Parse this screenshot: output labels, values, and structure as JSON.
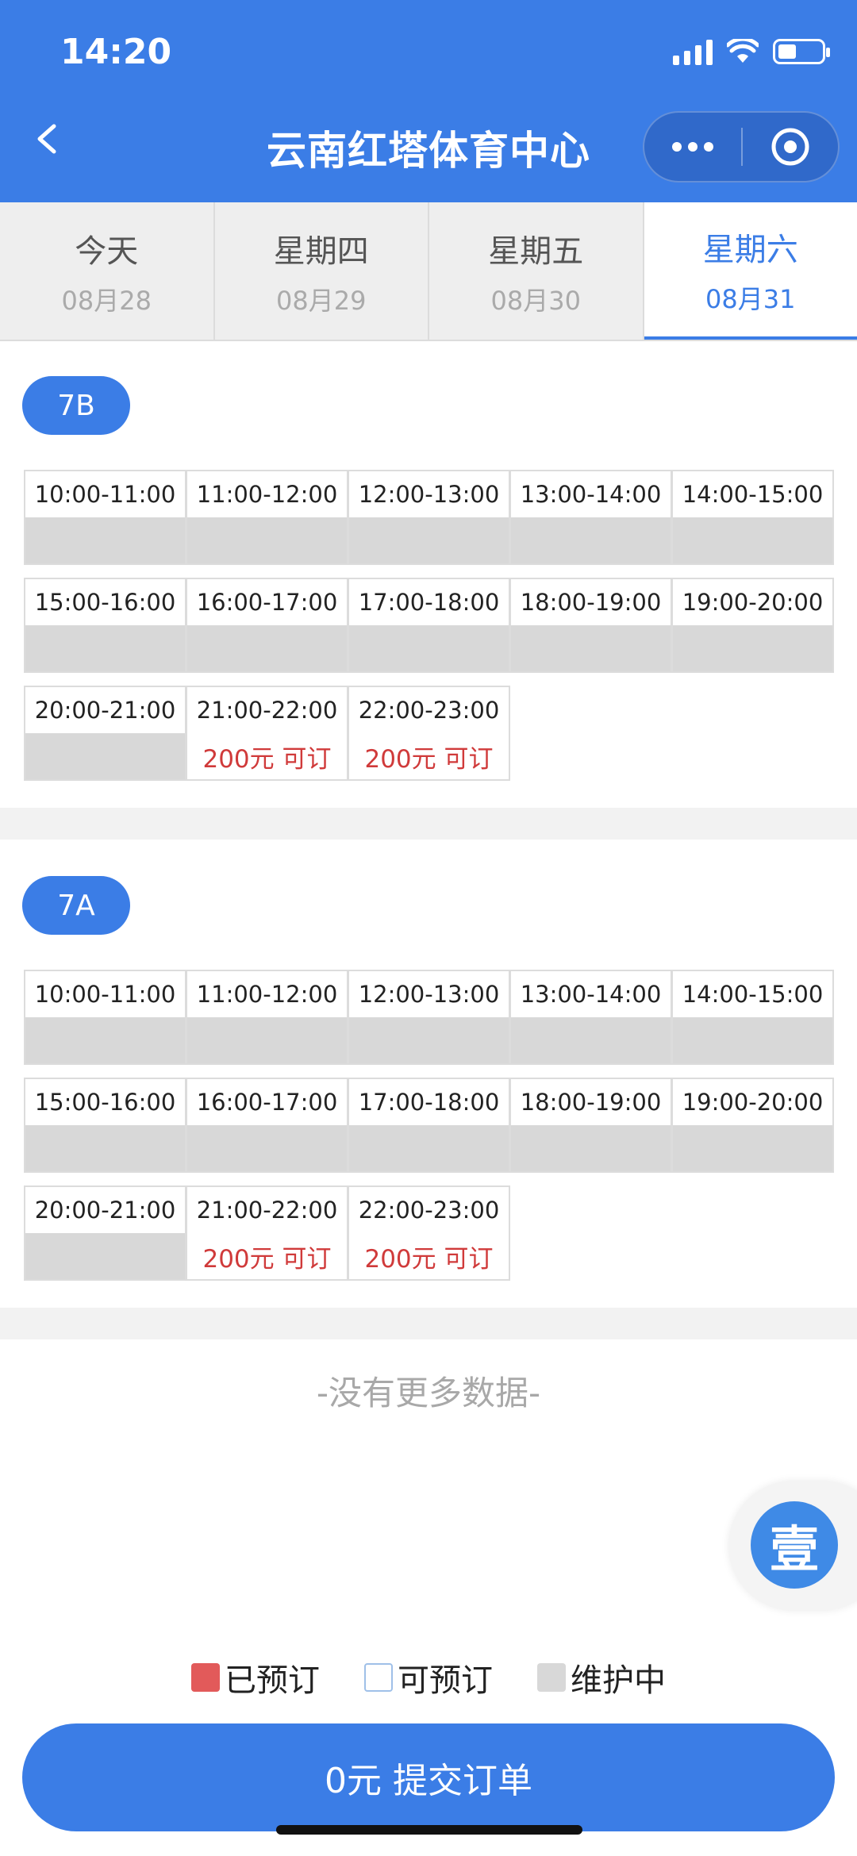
{
  "status_bar": {
    "time": "14:20"
  },
  "nav": {
    "title": "云南红塔体育中心"
  },
  "tabs": [
    {
      "day": "今天",
      "date": "08月28"
    },
    {
      "day": "星期四",
      "date": "08月29"
    },
    {
      "day": "星期五",
      "date": "08月30"
    },
    {
      "day": "星期六",
      "date": "08月31",
      "active": true
    }
  ],
  "courts": [
    {
      "name": "7B",
      "slots": [
        {
          "time": "10:00-11:00",
          "state": "",
          "status": "maintenance"
        },
        {
          "time": "11:00-12:00",
          "state": "",
          "status": "maintenance"
        },
        {
          "time": "12:00-13:00",
          "state": "",
          "status": "maintenance"
        },
        {
          "time": "13:00-14:00",
          "state": "",
          "status": "maintenance"
        },
        {
          "time": "14:00-15:00",
          "state": "",
          "status": "maintenance"
        },
        {
          "time": "15:00-16:00",
          "state": "",
          "status": "maintenance"
        },
        {
          "time": "16:00-17:00",
          "state": "",
          "status": "maintenance"
        },
        {
          "time": "17:00-18:00",
          "state": "",
          "status": "maintenance"
        },
        {
          "time": "18:00-19:00",
          "state": "",
          "status": "maintenance"
        },
        {
          "time": "19:00-20:00",
          "state": "",
          "status": "maintenance"
        },
        {
          "time": "20:00-21:00",
          "state": "",
          "status": "maintenance"
        },
        {
          "time": "21:00-22:00",
          "state": "200元 可订",
          "status": "available"
        },
        {
          "time": "22:00-23:00",
          "state": "200元 可订",
          "status": "available"
        }
      ]
    },
    {
      "name": "7A",
      "slots": [
        {
          "time": "10:00-11:00",
          "state": "",
          "status": "maintenance"
        },
        {
          "time": "11:00-12:00",
          "state": "",
          "status": "maintenance"
        },
        {
          "time": "12:00-13:00",
          "state": "",
          "status": "maintenance"
        },
        {
          "time": "13:00-14:00",
          "state": "",
          "status": "maintenance"
        },
        {
          "time": "14:00-15:00",
          "state": "",
          "status": "maintenance"
        },
        {
          "time": "15:00-16:00",
          "state": "",
          "status": "maintenance"
        },
        {
          "time": "16:00-17:00",
          "state": "",
          "status": "maintenance"
        },
        {
          "time": "17:00-18:00",
          "state": "",
          "status": "maintenance"
        },
        {
          "time": "18:00-19:00",
          "state": "",
          "status": "maintenance"
        },
        {
          "time": "19:00-20:00",
          "state": "",
          "status": "maintenance"
        },
        {
          "time": "20:00-21:00",
          "state": "",
          "status": "maintenance"
        },
        {
          "time": "21:00-22:00",
          "state": "200元 可订",
          "status": "available"
        },
        {
          "time": "22:00-23:00",
          "state": "200元 可订",
          "status": "available"
        }
      ]
    }
  ],
  "no_more_text": "-没有更多数据-",
  "float_button": {
    "label": "壹"
  },
  "legend": [
    {
      "label": "已预订",
      "color": "#e25a5a"
    },
    {
      "label": "可预订",
      "color": "#ffffff"
    },
    {
      "label": "维护中",
      "color": "#d8d8d8"
    }
  ],
  "submit": {
    "label": "0元 提交订单"
  },
  "colors": {
    "primary": "#3b7de6",
    "price": "#d03a3a"
  }
}
